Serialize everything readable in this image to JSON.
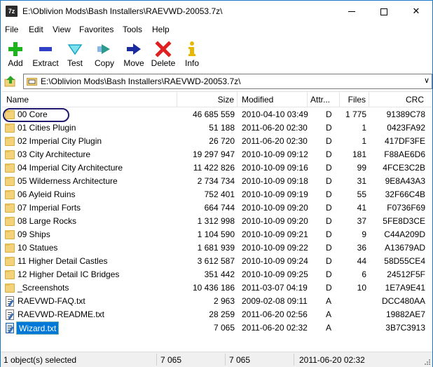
{
  "window": {
    "title": "E:\\Oblivion Mods\\Bash Installers\\RAEVWD-20053.7z\\",
    "app_icon_label": "7z",
    "controls": {
      "minimize_icon": "minimize-icon",
      "maximize_icon": "maximize-icon",
      "close_glyph": "✕"
    }
  },
  "menu": [
    "File",
    "Edit",
    "View",
    "Favorites",
    "Tools",
    "Help"
  ],
  "toolbar": [
    {
      "label": "Add",
      "icon": "plus-icon",
      "color": "#1bb51b"
    },
    {
      "label": "Extract",
      "icon": "minus-icon",
      "color": "#2f3fc6"
    },
    {
      "label": "Test",
      "icon": "check-icon",
      "color": "#1aa7c4"
    },
    {
      "label": "Copy",
      "icon": "copy-arrow-icon",
      "color": "#2a9a8a"
    },
    {
      "label": "Move",
      "icon": "move-arrow-icon",
      "color": "#1c2aa0"
    },
    {
      "label": "Delete",
      "icon": "delete-x-icon",
      "color": "#e02020"
    },
    {
      "label": "Info",
      "icon": "info-icon",
      "color": "#e8b800"
    }
  ],
  "address": {
    "path": "E:\\Oblivion Mods\\Bash Installers\\RAEVWD-20053.7z\\",
    "dropdown_glyph": "∨"
  },
  "columns": [
    "Name",
    "Size",
    "Modified",
    "Attr...",
    "Files",
    "CRC"
  ],
  "rows": [
    {
      "type": "folder",
      "name": "00 Core",
      "size": "46 685 559",
      "modified": "2010-04-10 03:49",
      "attr": "D",
      "files": "1 775",
      "crc": "91389C78"
    },
    {
      "type": "folder",
      "name": "01 Cities Plugin",
      "size": "51 188",
      "modified": "2011-06-20 02:30",
      "attr": "D",
      "files": "1",
      "crc": "0423FA92"
    },
    {
      "type": "folder",
      "name": "02 Imperial City Plugin",
      "size": "26 720",
      "modified": "2011-06-20 02:30",
      "attr": "D",
      "files": "1",
      "crc": "417DF3FE"
    },
    {
      "type": "folder",
      "name": "03 City Architecture",
      "size": "19 297 947",
      "modified": "2010-10-09 09:12",
      "attr": "D",
      "files": "181",
      "crc": "F88AE6D6"
    },
    {
      "type": "folder",
      "name": "04 Imperial City Architecture",
      "size": "11 422 826",
      "modified": "2010-10-09 09:16",
      "attr": "D",
      "files": "99",
      "crc": "4FCE3C2B"
    },
    {
      "type": "folder",
      "name": "05 Wilderness Architecture",
      "size": "2 734 734",
      "modified": "2010-10-09 09:18",
      "attr": "D",
      "files": "31",
      "crc": "9E8A43A3"
    },
    {
      "type": "folder",
      "name": "06 Ayleid Ruins",
      "size": "752 401",
      "modified": "2010-10-09 09:19",
      "attr": "D",
      "files": "55",
      "crc": "32F66C4B"
    },
    {
      "type": "folder",
      "name": "07 Imperial Forts",
      "size": "664 744",
      "modified": "2010-10-09 09:20",
      "attr": "D",
      "files": "41",
      "crc": "F0736F69"
    },
    {
      "type": "folder",
      "name": "08 Large Rocks",
      "size": "1 312 998",
      "modified": "2010-10-09 09:20",
      "attr": "D",
      "files": "37",
      "crc": "5FE8D3CE"
    },
    {
      "type": "folder",
      "name": "09 Ships",
      "size": "1 104 590",
      "modified": "2010-10-09 09:21",
      "attr": "D",
      "files": "9",
      "crc": "C44A209D"
    },
    {
      "type": "folder",
      "name": "10 Statues",
      "size": "1 681 939",
      "modified": "2010-10-09 09:22",
      "attr": "D",
      "files": "36",
      "crc": "A13679AD"
    },
    {
      "type": "folder",
      "name": "11 Higher Detail Castles",
      "size": "3 612 587",
      "modified": "2010-10-09 09:24",
      "attr": "D",
      "files": "44",
      "crc": "58D55CE4"
    },
    {
      "type": "folder",
      "name": "12 Higher Detail IC Bridges",
      "size": "351 442",
      "modified": "2010-10-09 09:25",
      "attr": "D",
      "files": "6",
      "crc": "24512F5F"
    },
    {
      "type": "folder",
      "name": "_Screenshots",
      "size": "10 436 186",
      "modified": "2011-03-07 04:19",
      "attr": "D",
      "files": "10",
      "crc": "1E7A9E41"
    },
    {
      "type": "file",
      "name": "RAEVWD-FAQ.txt",
      "size": "2 963",
      "modified": "2009-02-08 09:11",
      "attr": "A",
      "files": "",
      "crc": "DCC480AA"
    },
    {
      "type": "file",
      "name": "RAEVWD-README.txt",
      "size": "28 259",
      "modified": "2011-06-20 02:56",
      "attr": "A",
      "files": "",
      "crc": "19882AE7"
    },
    {
      "type": "file",
      "name": "Wizard.txt",
      "size": "7 065",
      "modified": "2011-06-20 02:32",
      "attr": "A",
      "files": "",
      "crc": "3B7C3913",
      "selected": true
    }
  ],
  "status": {
    "selection": "1 object(s) selected",
    "size": "7 065",
    "packed": "7 065",
    "modified": "2011-06-20 02:32"
  },
  "colors": {
    "selection": "#0078d7",
    "annotation_circle": "#1f1a6e",
    "folder": "#f3d27a"
  }
}
